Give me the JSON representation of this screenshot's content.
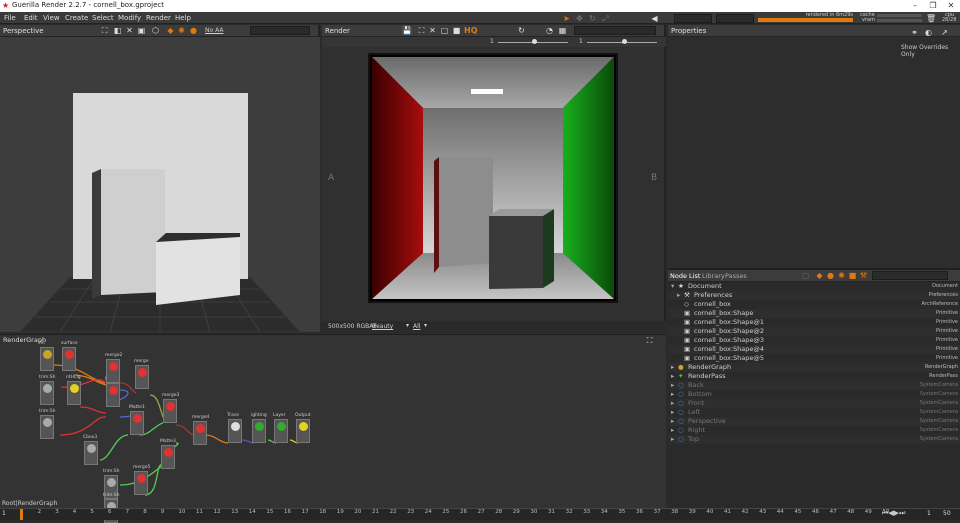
{
  "window": {
    "title": "Guerilla Render 2.2.7 - cornell_box.gproject"
  },
  "menu": [
    "File",
    "Edit",
    "View",
    "Create",
    "Select",
    "Modify",
    "Render",
    "Help"
  ],
  "status": {
    "render_status": "rendered in 6m29s",
    "cache_label": "cache",
    "vram_label": "vram",
    "cpu_label": "cpu",
    "cpu_value": "28/28"
  },
  "perspective": {
    "title": "Perspective",
    "aa_option": "No AA"
  },
  "render": {
    "title": "Render",
    "left_label": "A",
    "right_label": "B",
    "hq_label": "HQ",
    "slider_a_value": "1",
    "slider_b_value": "1",
    "resolution": "500x500 RGBAF",
    "channel": "Beauty",
    "layer": "All"
  },
  "properties": {
    "title": "Properties",
    "show_overrides": "Show Overrides Only"
  },
  "nodelist": {
    "tabs": [
      "Node List",
      "Library",
      "Passes"
    ],
    "rows": [
      {
        "name": "Document",
        "type": "Document",
        "dim": false
      },
      {
        "name": "Preferences",
        "type": "Preferences",
        "dim": false
      },
      {
        "name": "cornell_box",
        "type": "ArchReference",
        "dim": false
      },
      {
        "name": "cornell_box:Shape",
        "type": "Primitive",
        "dim": false
      },
      {
        "name": "cornell_box:Shape@1",
        "type": "Primitive",
        "dim": false
      },
      {
        "name": "cornell_box:Shape@2",
        "type": "Primitive",
        "dim": false
      },
      {
        "name": "cornell_box:Shape@3",
        "type": "Primitive",
        "dim": false
      },
      {
        "name": "cornell_box:Shape@4",
        "type": "Primitive",
        "dim": false
      },
      {
        "name": "cornell_box:Shape@5",
        "type": "Primitive",
        "dim": false
      },
      {
        "name": "RenderGraph",
        "type": "RenderGraph",
        "dim": false
      },
      {
        "name": "RenderPass",
        "type": "RenderPass",
        "dim": false
      },
      {
        "name": "Back",
        "type": "SystemCamera",
        "dim": true
      },
      {
        "name": "Bottom",
        "type": "SystemCamera",
        "dim": true
      },
      {
        "name": "Front",
        "type": "SystemCamera",
        "dim": true
      },
      {
        "name": "Left",
        "type": "SystemCamera",
        "dim": true
      },
      {
        "name": "Perspective",
        "type": "SystemCamera",
        "dim": true
      },
      {
        "name": "Right",
        "type": "SystemCamera",
        "dim": true
      },
      {
        "name": "Top",
        "type": "SystemCamera",
        "dim": true
      }
    ]
  },
  "rendergraph": {
    "title": "RenderGraph",
    "path": "Root|RenderGraph",
    "nodes": [
      {
        "label": "All",
        "color": "#c9a227"
      },
      {
        "label": "surface",
        "color": "#d33"
      },
      {
        "label": "trim:Sh",
        "color": "#aaa"
      },
      {
        "label": "ntHLig",
        "color": "#e4d21f"
      },
      {
        "label": "Matte",
        "color": "#d33"
      },
      {
        "label": "merge2",
        "color": "#d33"
      },
      {
        "label": "merge",
        "color": "#d33"
      },
      {
        "label": "trim:Sh",
        "color": "#aaa"
      },
      {
        "label": "Matte1",
        "color": "#d33"
      },
      {
        "label": "merge3",
        "color": "#d33"
      },
      {
        "label": "Cbox3",
        "color": "#aaa"
      },
      {
        "label": "Matte3",
        "color": "#d33"
      },
      {
        "label": "merge4",
        "color": "#d33"
      },
      {
        "label": "Trace",
        "color": "#ddd"
      },
      {
        "label": "ighting",
        "color": "#3a3"
      },
      {
        "label": "Layer",
        "color": "#3a3"
      },
      {
        "label": "Output",
        "color": "#e4d21f"
      },
      {
        "label": "trim:Sh",
        "color": "#aaa"
      },
      {
        "label": "merge5",
        "color": "#d33"
      },
      {
        "label": "trim:Sh",
        "color": "#aaa"
      }
    ]
  },
  "timeline": {
    "ticks": [
      "1",
      "2",
      "3",
      "4",
      "5",
      "6",
      "7",
      "8",
      "9",
      "10",
      "11",
      "12",
      "13",
      "14",
      "15",
      "16",
      "17",
      "18",
      "19",
      "20",
      "21",
      "22",
      "23",
      "24",
      "25",
      "26",
      "27",
      "28",
      "29",
      "30",
      "31",
      "32",
      "33",
      "34",
      "35",
      "36",
      "37",
      "38",
      "39",
      "40",
      "41",
      "42",
      "43",
      "44",
      "45",
      "46",
      "47",
      "48",
      "49",
      "50"
    ],
    "start": "1",
    "end": "50",
    "current": "1"
  },
  "colors": {
    "accent": "#e07a10",
    "panel": "#2b2b2b",
    "header": "#3c3c3c"
  }
}
